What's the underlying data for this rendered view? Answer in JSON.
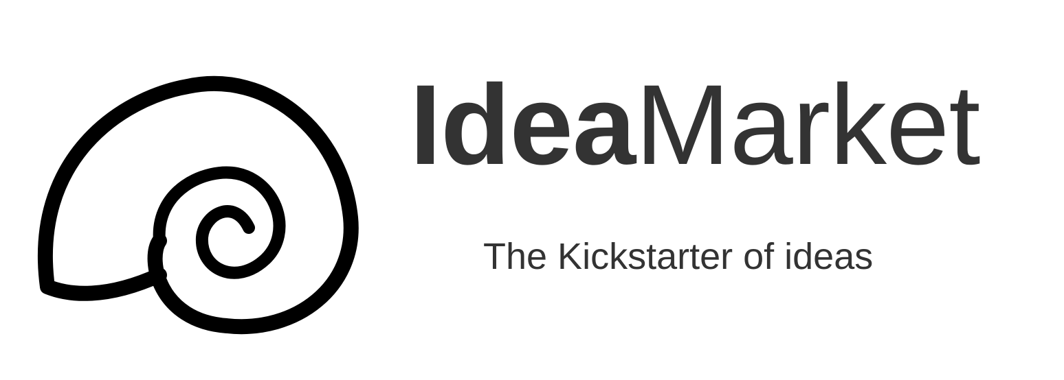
{
  "brand": {
    "name_bold": "Idea",
    "name_regular": "Market",
    "tagline": "The Kickstarter of ideas"
  },
  "logo": {
    "icon": "snail-shell-spiral-icon"
  },
  "colors": {
    "text": "#333333",
    "logo_stroke": "#000000",
    "background": "#ffffff"
  }
}
